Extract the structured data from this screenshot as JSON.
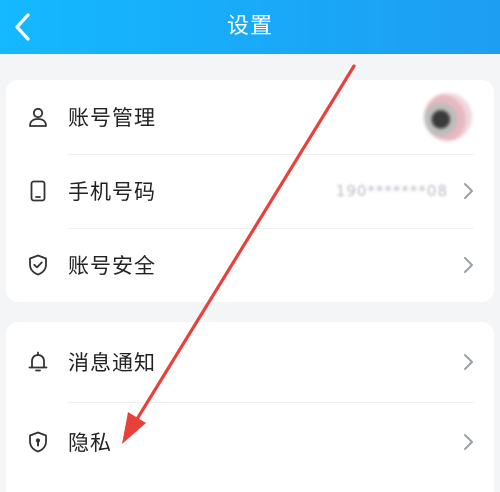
{
  "header": {
    "title": "设置"
  },
  "account_card": {
    "items": [
      {
        "label": "账号管理"
      },
      {
        "label": "手机号码",
        "value": "190*******08"
      },
      {
        "label": "账号安全"
      }
    ]
  },
  "settings_card": {
    "items": [
      {
        "label": "消息通知"
      },
      {
        "label": "隐私"
      }
    ]
  },
  "colors": {
    "accent": "#1aa7f7",
    "annotation_arrow": "#e8403a"
  },
  "icons": [
    "back-arrow-icon",
    "person-icon",
    "phone-icon",
    "shield-check-icon",
    "bell-icon",
    "privacy-shield-icon",
    "chevron-right-icon"
  ]
}
